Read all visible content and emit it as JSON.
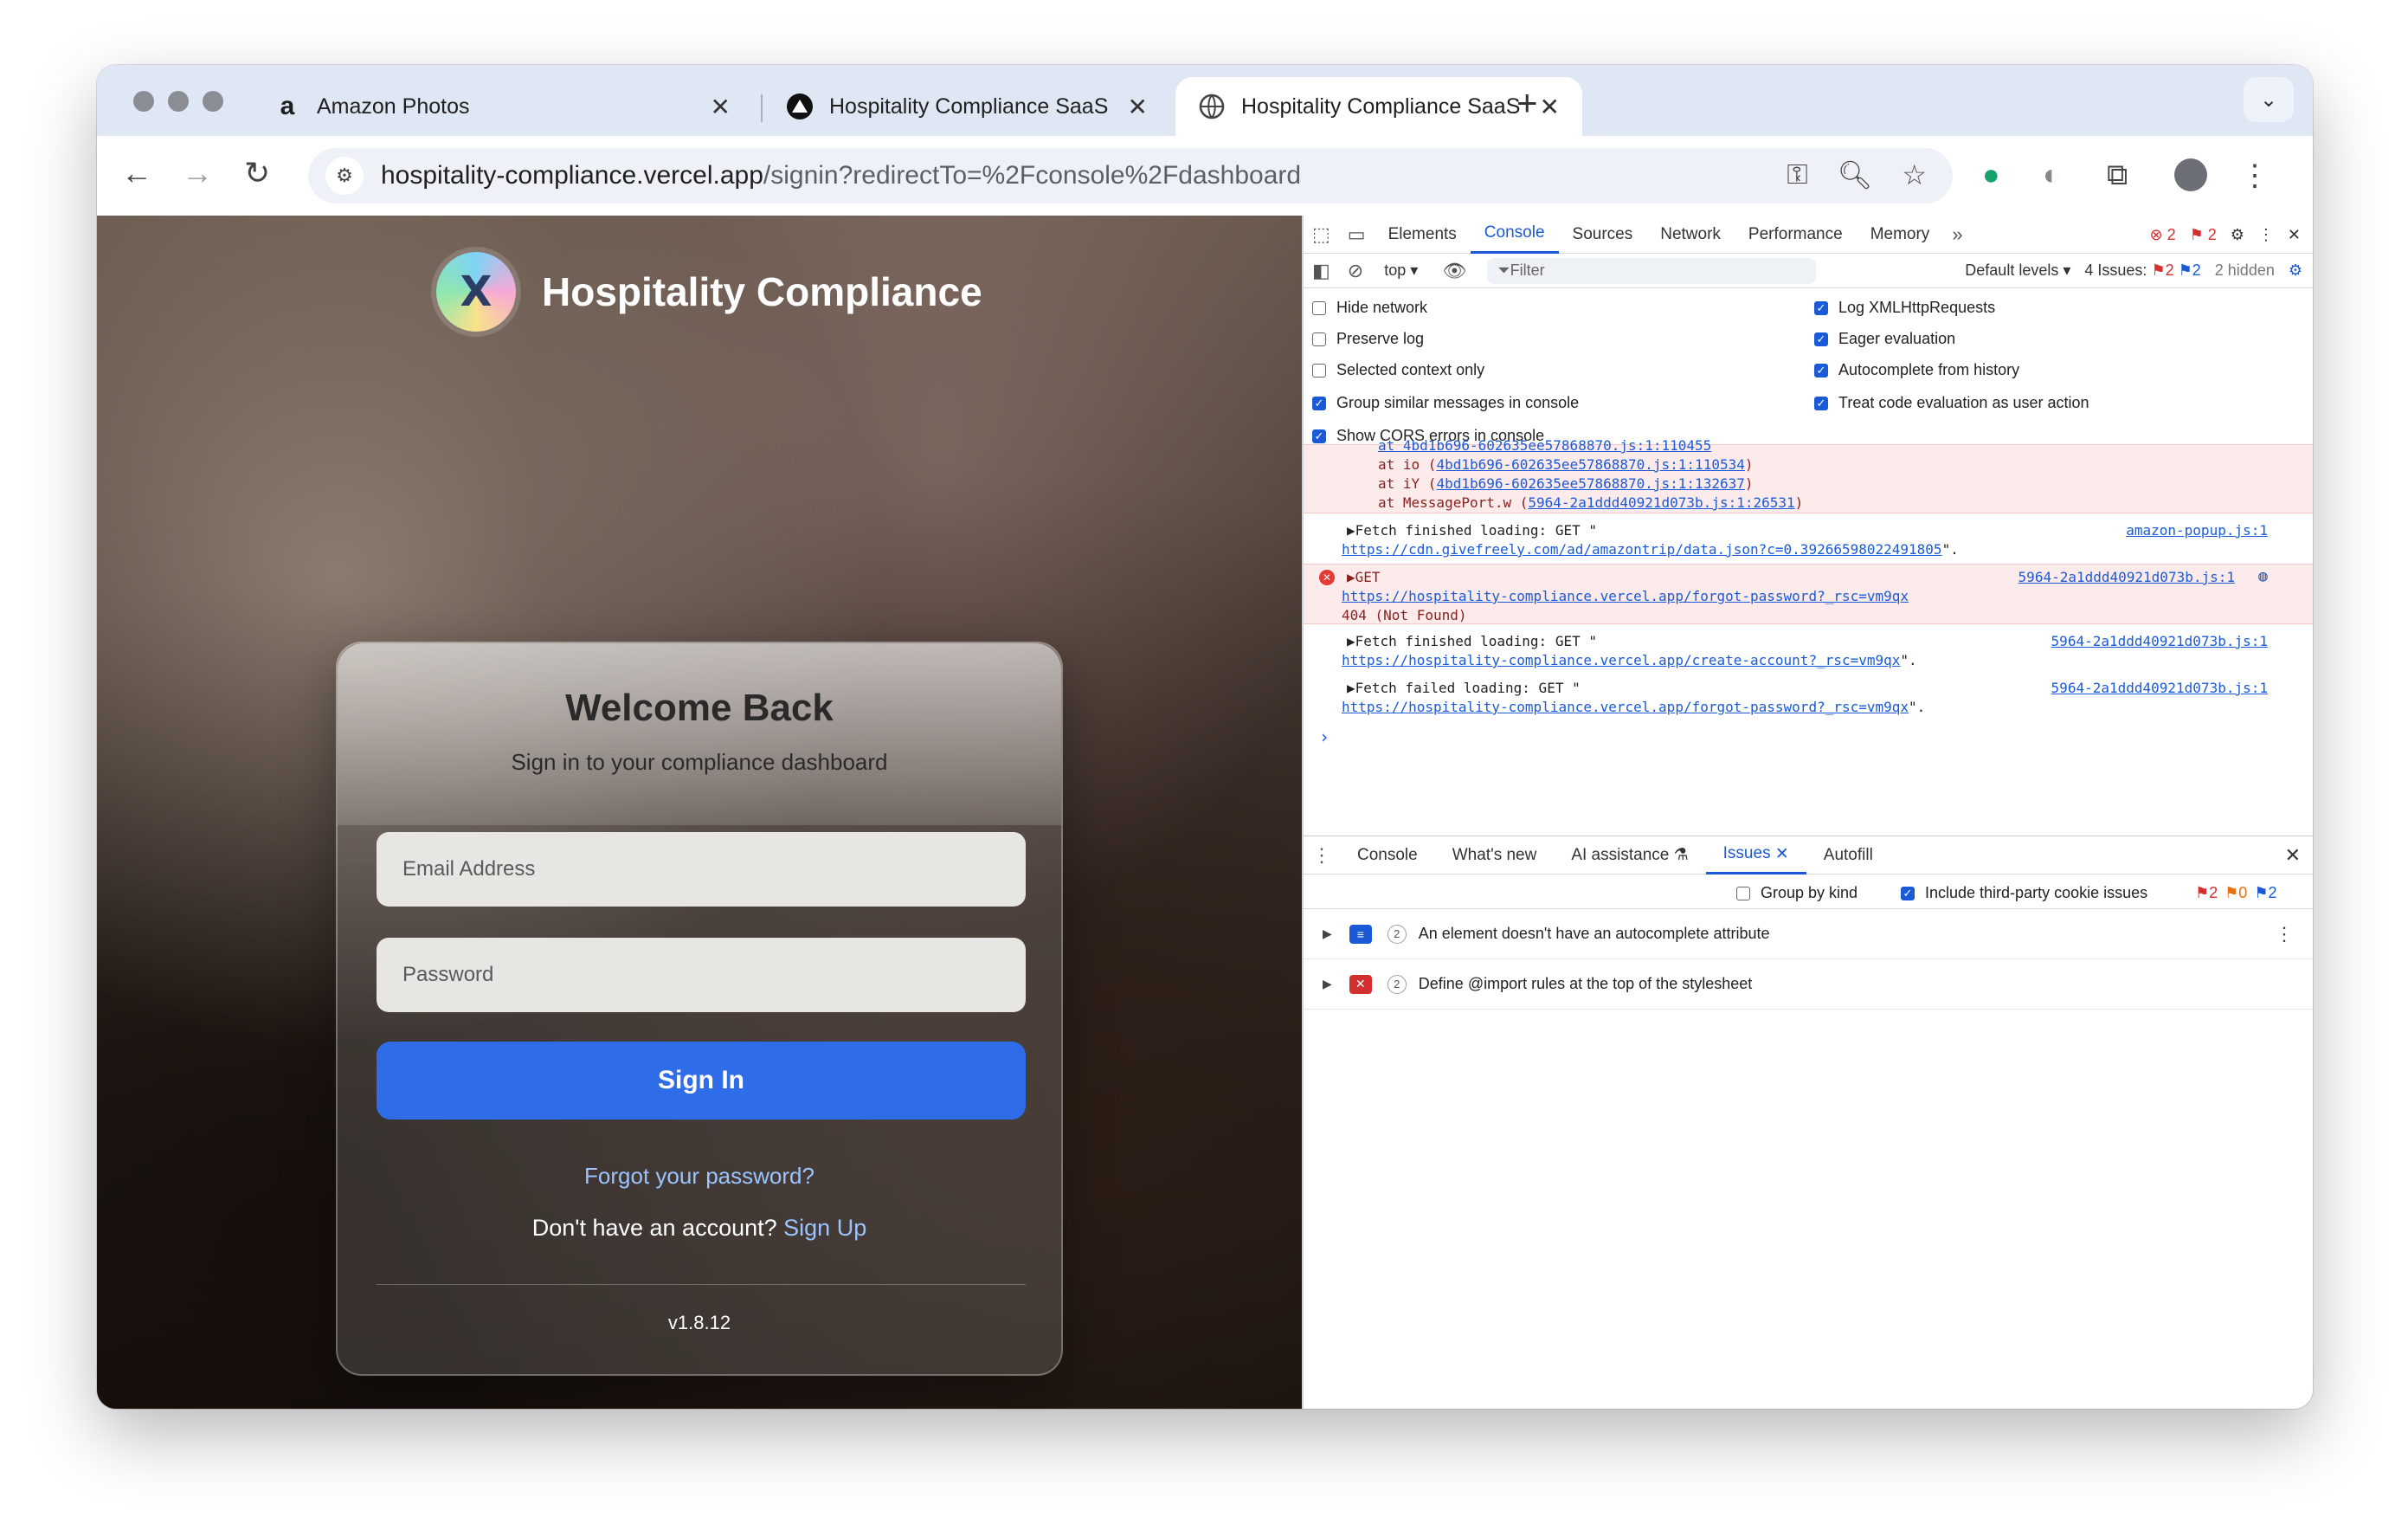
{
  "browser": {
    "tabs": [
      {
        "title": "Amazon Photos",
        "favicon": "amazon-icon"
      },
      {
        "title": "Hospitality Compliance SaaS",
        "favicon": "vercel-triangle-icon"
      },
      {
        "title": "Hospitality Compliance SaaS",
        "favicon": "globe-icon",
        "active": true
      }
    ],
    "url_host": "hospitality-compliance.vercel.app",
    "url_path": "/signin?redirectTo=%2Fconsole%2Fdashboard"
  },
  "page": {
    "brand_name": "Hospitality Compliance",
    "welcome": "Welcome Back",
    "subtitle": "Sign in to your compliance dashboard",
    "email_placeholder": "Email Address",
    "password_placeholder": "Password",
    "sign_in": "Sign In",
    "forgot": "Forgot your password?",
    "no_account": "Don't have an account?",
    "sign_up": "Sign Up",
    "version": "v1.8.12"
  },
  "devtools": {
    "tabs": [
      "Elements",
      "Console",
      "Sources",
      "Network",
      "Performance",
      "Memory"
    ],
    "active_tab": "Console",
    "error_count": "2",
    "issue_count": "2",
    "context": "top",
    "filter_placeholder": "Filter",
    "levels": "Default levels",
    "issues_label": "4 Issues:",
    "issues_err": "2",
    "issues_info": "2",
    "hidden": "2 hidden",
    "options_left": [
      {
        "label": "Hide network",
        "checked": false
      },
      {
        "label": "Preserve log",
        "checked": false
      },
      {
        "label": "Selected context only",
        "checked": false
      },
      {
        "label": "Group similar messages in console",
        "checked": true
      },
      {
        "label": "Show CORS errors in console",
        "checked": true
      }
    ],
    "options_right": [
      {
        "label": "Log XMLHttpRequests",
        "checked": true
      },
      {
        "label": "Eager evaluation",
        "checked": true
      },
      {
        "label": "Autocomplete from history",
        "checked": true
      },
      {
        "label": "Treat code evaluation as user action",
        "checked": true
      }
    ],
    "console": {
      "stack_cut": "at 4bd1b696-602635ee57868870.js:1:110455",
      "stack": [
        {
          "prefix": "at io (",
          "link": "4bd1b696-602635ee57868870.js:1:110534",
          "suffix": ")"
        },
        {
          "prefix": "at iY (",
          "link": "4bd1b696-602635ee57868870.js:1:132637",
          "suffix": ")"
        },
        {
          "prefix": "at MessagePort.w (",
          "link": "5964-2a1ddd40921d073b.js:1:26531",
          "suffix": ")"
        }
      ],
      "msg1_text": "▶Fetch finished loading: GET \"",
      "msg1_url": "https://cdn.givefreely.com/ad/amazontrip/data.json?c=0.39266598022491805",
      "msg1_end": "\".",
      "msg1_src": "amazon-popup.js:1",
      "msg2_text": "▶GET",
      "msg2_url": "https://hospitality-compliance.vercel.app/forgot-password?_rsc=vm9qx",
      "msg2_status": "404 (Not Found)",
      "msg2_src": "5964-2a1ddd40921d073b.js:1",
      "msg3_text": "▶Fetch finished loading: GET \"",
      "msg3_url": "https://hospitality-compliance.vercel.app/create-account?_rsc=vm9qx",
      "msg3_end": "\".",
      "msg3_src": "5964-2a1ddd40921d073b.js:1",
      "msg4_text": "▶Fetch failed loading: GET \"",
      "msg4_url": "https://hospitality-compliance.vercel.app/forgot-password?_rsc=vm9qx",
      "msg4_end": "\".",
      "msg4_src": "5964-2a1ddd40921d073b.js:1"
    },
    "drawer": {
      "tabs": [
        "Console",
        "What's new",
        "AI assistance",
        "Issues",
        "Autofill"
      ],
      "active": "Issues",
      "group_by_kind": "Group by kind",
      "third_party": "Include third-party cookie issues",
      "counts": {
        "error": "2",
        "warning": "0",
        "info": "2"
      },
      "issues": [
        {
          "kind": "info",
          "count": "2",
          "text": "An element doesn't have an autocomplete attribute"
        },
        {
          "kind": "error",
          "count": "2",
          "text": "Define @import rules at the top of the stylesheet"
        }
      ]
    }
  }
}
